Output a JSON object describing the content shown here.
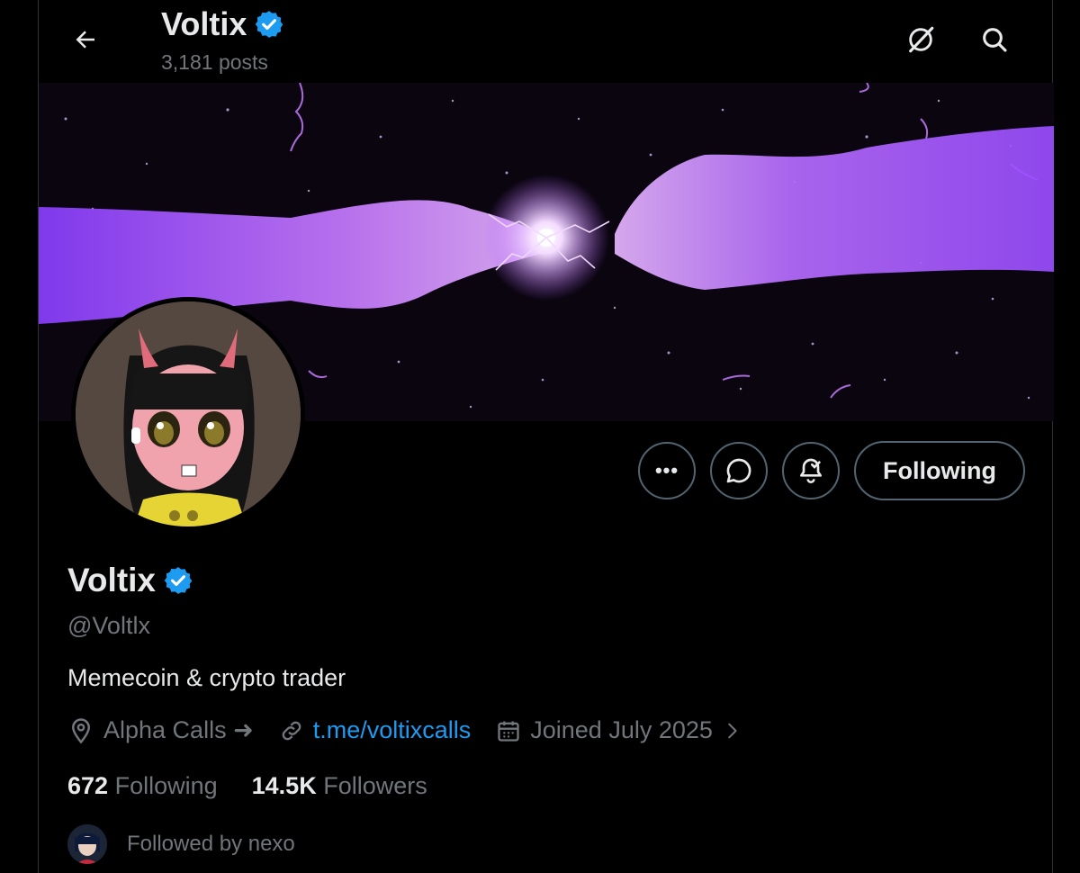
{
  "header": {
    "title": "Voltix",
    "posts_count": "3,181 posts"
  },
  "icons": {
    "back": "arrow-left-icon",
    "grok": "grok-icon",
    "search": "search-icon",
    "verified": "verified-badge-icon"
  },
  "actions": {
    "more": "•••",
    "following_label": "Following"
  },
  "profile": {
    "display_name": "Voltix",
    "handle": "@Voltlx",
    "bio": "Memecoin & crypto trader",
    "location": "Alpha Calls ➜",
    "website": "t.me/voltixcalls",
    "joined": "Joined July 2025"
  },
  "stats": {
    "following_count": "672",
    "following_label": "Following",
    "followers_count": "14.5K",
    "followers_label": "Followers"
  },
  "followed_by": "Followed by nexo",
  "colors": {
    "background": "#000000",
    "text_primary": "#e7e9ea",
    "text_secondary": "#71767b",
    "link": "#1d9bf0",
    "verified": "#1d9bf0",
    "banner_accent": "#b25cff"
  }
}
